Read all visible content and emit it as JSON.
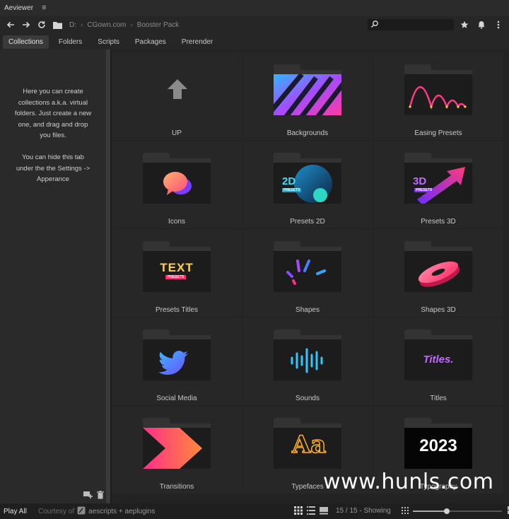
{
  "app": {
    "title": "Aeviewer",
    "menu_icon": "hamburger-icon"
  },
  "toolbar": {
    "breadcrumbs": [
      "D:",
      "CGown.com",
      "Booster Pack"
    ],
    "search_placeholder": ""
  },
  "tabs": [
    {
      "label": "Collections",
      "active": true
    },
    {
      "label": "Folders",
      "active": false
    },
    {
      "label": "Scripts",
      "active": false
    },
    {
      "label": "Packages",
      "active": false
    },
    {
      "label": "Prerender",
      "active": false
    }
  ],
  "sidebar": {
    "text": "Here you can create\ncollections a.k.a. virtual\nfolders. Just create a new\none, and drag and drop\nyou files.\n\nYou can hide this tab\nunder the the Settings ->\nApperance"
  },
  "grid": {
    "items": [
      {
        "label": "UP",
        "thumb": "up-arrow"
      },
      {
        "label": "Backgrounds",
        "thumb": "backgrounds"
      },
      {
        "label": "Easing Presets",
        "thumb": "easing"
      },
      {
        "label": "Icons",
        "thumb": "icons"
      },
      {
        "label": "Presets 2D",
        "thumb": "presets2d",
        "badge_top": "2D",
        "badge_bottom": "PRESETS"
      },
      {
        "label": "Presets 3D",
        "thumb": "presets3d",
        "badge_top": "3D",
        "badge_bottom": "PRESETS"
      },
      {
        "label": "Presets Titles",
        "thumb": "titles-text",
        "badge_top": "TEXT",
        "badge_bottom": "PRESETS"
      },
      {
        "label": "Shapes",
        "thumb": "shapes"
      },
      {
        "label": "Shapes 3D",
        "thumb": "shapes3d"
      },
      {
        "label": "Social Media",
        "thumb": "social"
      },
      {
        "label": "Sounds",
        "thumb": "sounds"
      },
      {
        "label": "Titles",
        "thumb": "titles",
        "badge_top": "Titles."
      },
      {
        "label": "Transitions",
        "thumb": "transitions"
      },
      {
        "label": "Typefaces",
        "thumb": "typefaces",
        "badge_top": "Aa"
      },
      {
        "label": "Typography",
        "thumb": "typography",
        "badge_top": "2023"
      }
    ]
  },
  "bottombar": {
    "play_all": "Play All",
    "courtesy_prefix": "Courtesy of",
    "courtesy_brand": "aescripts + aeplugins",
    "count": "15 / 15 - Showing",
    "zoom_level": 0.38
  },
  "watermark": "www.hunls.com",
  "colors": {
    "accent_pink": "#ff2d7a",
    "accent_purple": "#8a3cff",
    "accent_cyan": "#35d6e6"
  }
}
